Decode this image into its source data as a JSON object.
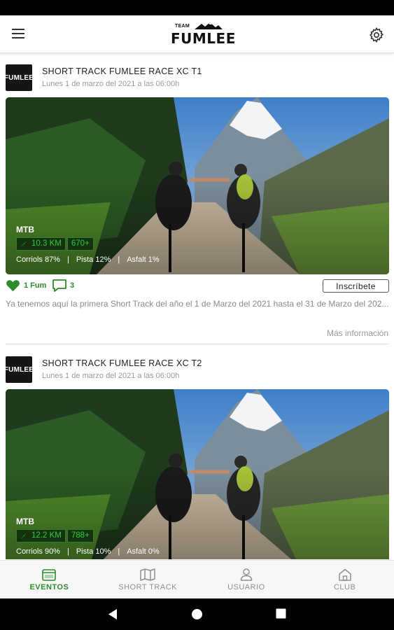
{
  "app": {
    "logo_top": "TEAM",
    "logo_main": "FUMLEE",
    "menu_icon": "hamburger-menu-icon",
    "settings_icon": "gear-icon"
  },
  "events": [
    {
      "avatar_text": "FUMLEE",
      "title": "SHORT TRACK FUMLEE RACE XC T1",
      "date": "Lunes 1 de marzo del 2021 a las 06:00h",
      "type": "MTB",
      "distance": "10.3 KM",
      "elevation": "670+",
      "terrain": [
        "Corriols 87%",
        "Pista 12%",
        "Asfalt 1%"
      ],
      "likes": "1 Fum",
      "comments": "3",
      "signup_label": "Inscríbete",
      "description": "Ya tenemos aquí la primera Short Track del año el 1 de Marzo del 2021 hasta el 31 de Marzo del 202...",
      "more_label": "Más información"
    },
    {
      "avatar_text": "FUMLEE",
      "title": "SHORT TRACK FUMLEE RACE XC T2",
      "date": "Lunes 1 de marzo del 2021 a las 06:00h",
      "type": "MTB",
      "distance": "12.2 KM",
      "elevation": "788+",
      "terrain": [
        "Corriols 90%",
        "Pista 10%",
        "Asfalt 0%"
      ]
    }
  ],
  "bottom_nav": [
    {
      "label": "EVENTOS",
      "icon": "calendar-icon",
      "active": true
    },
    {
      "label": "SHORT TRACK",
      "icon": "map-icon",
      "active": false
    },
    {
      "label": "USUARIO",
      "icon": "user-icon",
      "active": false
    },
    {
      "label": "CLUB",
      "icon": "home-icon",
      "active": false
    }
  ],
  "colors": {
    "accent": "#2e8b2e",
    "chip_text": "#2ecc40",
    "muted_text": "#8a8a8a"
  }
}
